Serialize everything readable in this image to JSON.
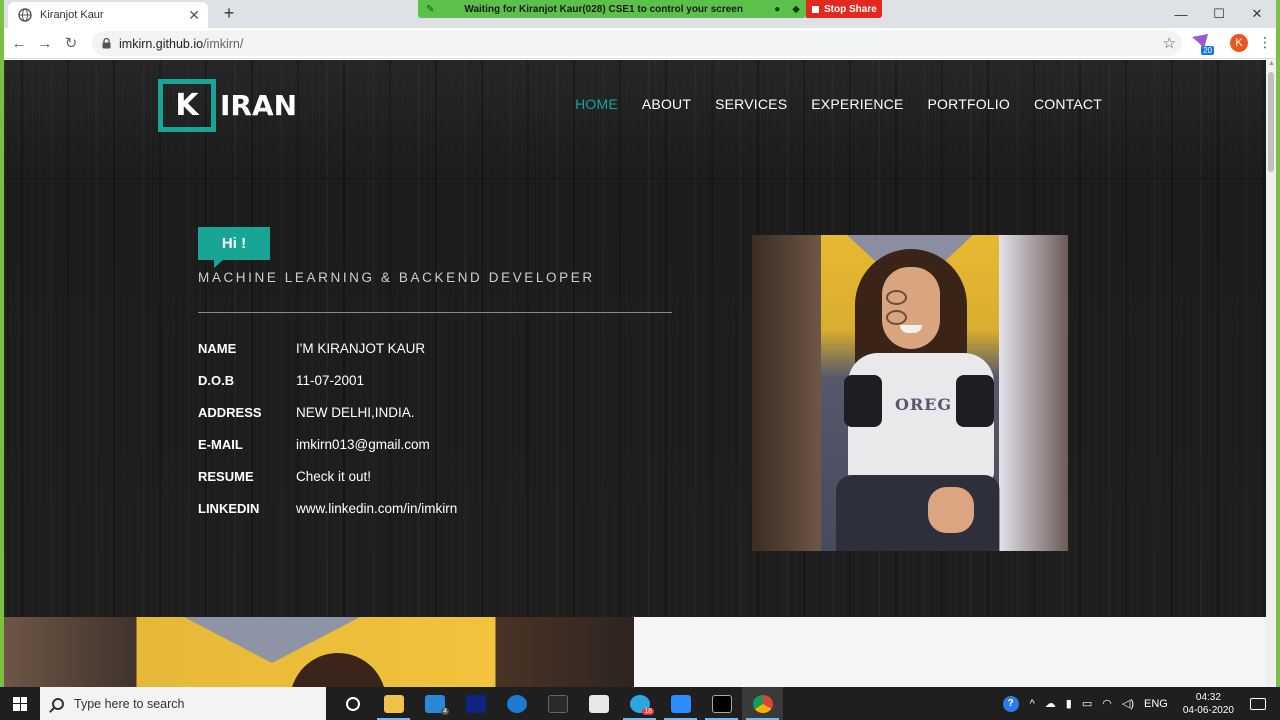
{
  "browser": {
    "tab_title": "Kiranjot Kaur",
    "url_host": "imkirn.github.io",
    "url_path": "/imkirn/",
    "extension_badge": "20",
    "profile_initial": "K"
  },
  "screenshare": {
    "message": "Waiting for Kiranjot Kaur(028) CSE1 to control your screen",
    "stop_label": "Stop Share"
  },
  "site": {
    "logo_letter": "K",
    "logo_rest": "IRAN",
    "nav": [
      "HOME",
      "ABOUT",
      "SERVICES",
      "EXPERIENCE",
      "PORTFOLIO",
      "CONTACT"
    ],
    "active_nav": "HOME",
    "accent_color": "#18a595",
    "hi_badge": "Hi !",
    "subtitle": "MACHINE LEARNING & BACKEND DEVELOPER",
    "info": [
      {
        "label": "NAME",
        "value": "I'M KIRANJOT KAUR"
      },
      {
        "label": "D.O.B",
        "value": "11-07-2001"
      },
      {
        "label": "ADDRESS",
        "value": "NEW DELHI,INDIA."
      },
      {
        "label": "E-MAIL",
        "value": "imkirn013@gmail.com"
      },
      {
        "label": "RESUME",
        "value": "Check it out!"
      },
      {
        "label": "LINKEDIN",
        "value": "www.linkedin.com/in/imkirn"
      }
    ]
  },
  "taskbar": {
    "search_placeholder": "Type here to search",
    "mail_badge": "4",
    "telegram_badge": "18",
    "language": "ENG",
    "time": "04:32",
    "date": "04-06-2020"
  }
}
